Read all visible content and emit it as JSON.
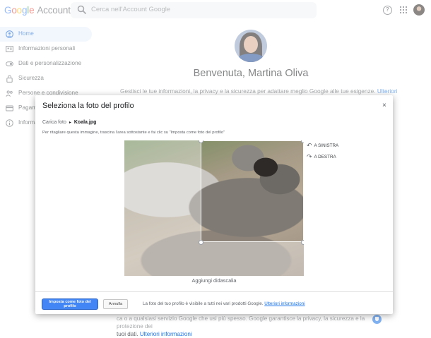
{
  "header": {
    "logo_letters": [
      "G",
      "o",
      "o",
      "g",
      "l",
      "e"
    ],
    "logo_suffix": "Account",
    "search_placeholder": "Cerca nell'Account Google"
  },
  "sidebar": {
    "items": [
      {
        "label": "Home",
        "icon": "home-icon",
        "active": true
      },
      {
        "label": "Informazioni personali",
        "icon": "id-card-icon"
      },
      {
        "label": "Dati e personalizzazione",
        "icon": "toggle-icon"
      },
      {
        "label": "Sicurezza",
        "icon": "lock-icon"
      },
      {
        "label": "Persone e condivisione",
        "icon": "people-icon"
      },
      {
        "label": "Pagame",
        "icon": "card-icon"
      },
      {
        "label": "Informa",
        "icon": "info-icon"
      }
    ]
  },
  "main": {
    "welcome": "Benvenuta, Martina Oliva",
    "intro_text": "Gestisci le tue informazioni, la privacy e la sicurezza per adattare meglio Google alle tue esigenze.",
    "intro_link": "Ulteriori",
    "footer_line1": "ca o a qualsiasi servizio Google che usi più spesso. Google garantisce la privacy, la sicurezza e la protezione dei",
    "footer_line2": "tuoi dati.",
    "footer_link": "Ulteriori informazioni"
  },
  "dialog": {
    "title": "Seleziona la foto del profilo",
    "close": "×",
    "breadcrumb_parent": "Carica foto",
    "breadcrumb_sep": "▸",
    "breadcrumb_file": "Koala.jpg",
    "instructions": "Per ritagliare questa immagine, trascina l'area sottostante e fai clic su \"Imposta come foto del profilo\"",
    "rotate_left": "A SINISTRA",
    "rotate_right": "A DESTRA",
    "caption": "Aggiungi didascalia",
    "primary_button": "Imposta come foto del profilo",
    "cancel_button": "Annulla",
    "footnote": "La foto del tuo profilo è visibile a tutti nei vari prodotti Google.",
    "footnote_link": "Ulteriori informazioni"
  },
  "colors": {
    "accent": "#1a73e8",
    "active_bg": "#e8f0fe",
    "primary_button": "#4285f4"
  }
}
